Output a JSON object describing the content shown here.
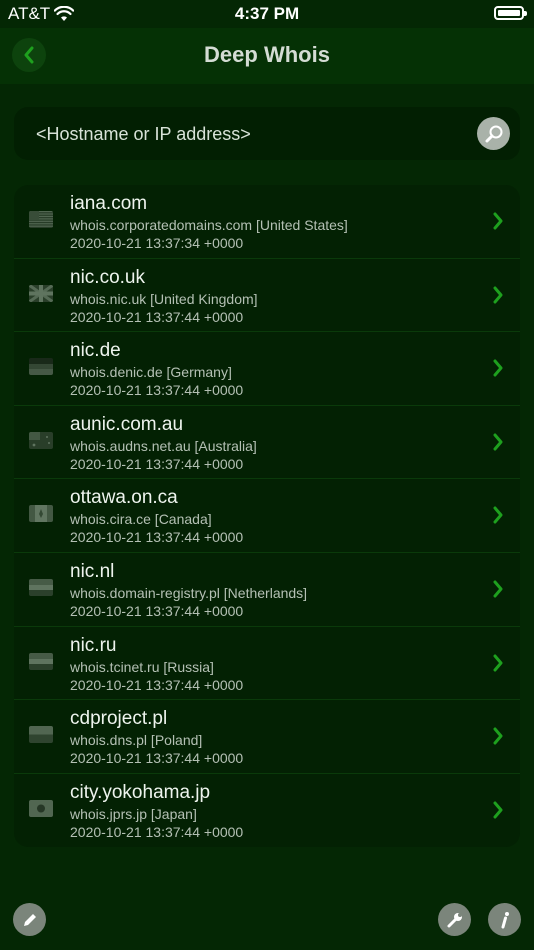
{
  "status": {
    "carrier": "AT&T",
    "time": "4:37 PM"
  },
  "nav": {
    "title": "Deep Whois",
    "back_icon": "chevron-left-icon"
  },
  "search": {
    "placeholder": "<Hostname or IP address>",
    "value": ""
  },
  "accent": "#1ea01e",
  "rows": [
    {
      "domain": "iana.com",
      "server": "whois.corporatedomains.com [United States]",
      "date": "2020-10-21 13:37:34 +0000",
      "flag": "us"
    },
    {
      "domain": "nic.co.uk",
      "server": "whois.nic.uk [United Kingdom]",
      "date": "2020-10-21 13:37:44 +0000",
      "flag": "uk"
    },
    {
      "domain": "nic.de",
      "server": "whois.denic.de [Germany]",
      "date": "2020-10-21 13:37:44 +0000",
      "flag": "de"
    },
    {
      "domain": "aunic.com.au",
      "server": "whois.audns.net.au [Australia]",
      "date": "2020-10-21 13:37:44 +0000",
      "flag": "au"
    },
    {
      "domain": "ottawa.on.ca",
      "server": "whois.cira.ce [Canada]",
      "date": "2020-10-21 13:37:44 +0000",
      "flag": "ca"
    },
    {
      "domain": "nic.nl",
      "server": "whois.domain-registry.pl [Netherlands]",
      "date": "2020-10-21 13:37:44 +0000",
      "flag": "nl"
    },
    {
      "domain": "nic.ru",
      "server": "whois.tcinet.ru [Russia]",
      "date": "2020-10-21 13:37:44 +0000",
      "flag": "ru"
    },
    {
      "domain": "cdproject.pl",
      "server": "whois.dns.pl [Poland]",
      "date": "2020-10-21 13:37:44 +0000",
      "flag": "pl"
    },
    {
      "domain": "city.yokohama.jp",
      "server": "whois.jprs.jp [Japan]",
      "date": "2020-10-21 13:37:44 +0000",
      "flag": "jp"
    }
  ],
  "toolbar": {
    "edit_icon": "pencil-icon",
    "tools_icon": "wrench-icon",
    "info_icon": "info-icon"
  }
}
